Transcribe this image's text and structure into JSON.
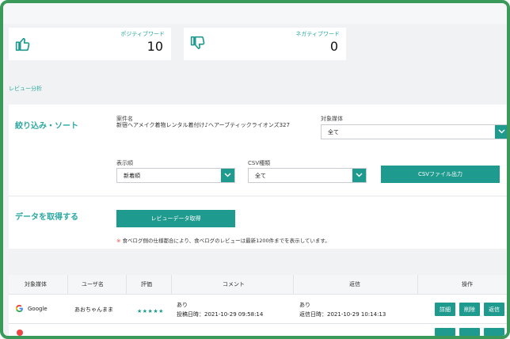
{
  "kpis": {
    "positive": {
      "label": "ポジティブワード",
      "value": "10"
    },
    "negative": {
      "label": "ネガティブワード",
      "value": "0"
    }
  },
  "section_link": "レビュー分析",
  "filters": {
    "title": "絞り込み・ソート",
    "store_label": "案件名",
    "store_name": "新宿ヘアメイク着物レンタル着付け♪ヘアーブティックライオンズ327",
    "media_label": "対象媒体",
    "media_value": "全て",
    "order_label": "表示順",
    "order_value": "新着順",
    "csv_label": "CSV種類",
    "csv_value": "全て",
    "csv_button": "CSVファイル出力"
  },
  "data_fetch": {
    "title": "データを取得する",
    "button": "レビューデータ取得",
    "note_mark": "※",
    "note": "食べログ側の仕様都合により、食べログのレビューは最新1200件までを表示しています。"
  },
  "table": {
    "headers": [
      "対象媒体",
      "ユーザ名",
      "評価",
      "コメント",
      "返信",
      "操作"
    ],
    "rows": [
      {
        "media": "Google",
        "user": "あおちゃんまま",
        "rating": "★★★★★",
        "comment_status": "あり",
        "comment_time": "投稿日時：2021-10-29 09:58:14",
        "reply_status": "あり",
        "reply_time": "返信日時：2021-10-29 10:14:13",
        "actions": [
          "詳細",
          "削除",
          "返信"
        ]
      }
    ]
  },
  "colors": {
    "accent": "#1f9a8f",
    "frame": "#3a9a5a",
    "background": "#f1f2f3"
  }
}
